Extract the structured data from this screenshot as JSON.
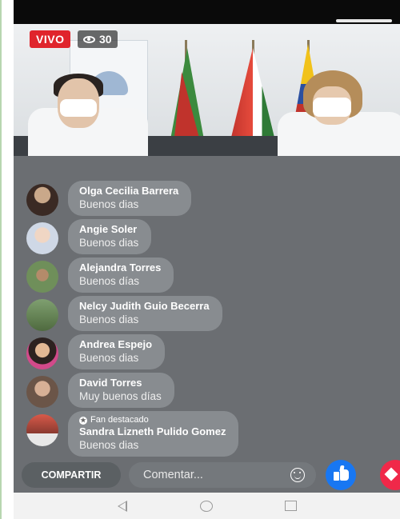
{
  "live": {
    "label": "VIVO",
    "viewers": "30"
  },
  "comments": [
    {
      "name": "Olga Cecilia Barrera",
      "text": "Buenos dias",
      "avatar": "avatar-dark-hair"
    },
    {
      "name": "Angie Soler",
      "text": "Buenos dias",
      "avatar": "avatar-light"
    },
    {
      "name": "Alejandra Torres",
      "text": "Buenos días",
      "avatar": "avatar-outdoor"
    },
    {
      "name": "Nelcy Judith Guio Becerra",
      "text": "Buenos dias",
      "avatar": "avatar-group"
    },
    {
      "name": "Andrea Espejo",
      "text": "Buenos dias",
      "avatar": "avatar-child"
    },
    {
      "name": "David Torres",
      "text": "Muy buenos días",
      "avatar": "avatar-man"
    },
    {
      "name": "Sandra Lizneth Pulido Gomez",
      "text": "Buenos dias",
      "badge": "Fan destacado",
      "avatar": "avatar-group2"
    }
  ],
  "bottom": {
    "share_label": "COMPARTIR",
    "comment_placeholder": "Comentar..."
  },
  "colors": {
    "live_red": "#e0242c",
    "like_blue": "#1877f2",
    "love_red": "#f02849"
  }
}
